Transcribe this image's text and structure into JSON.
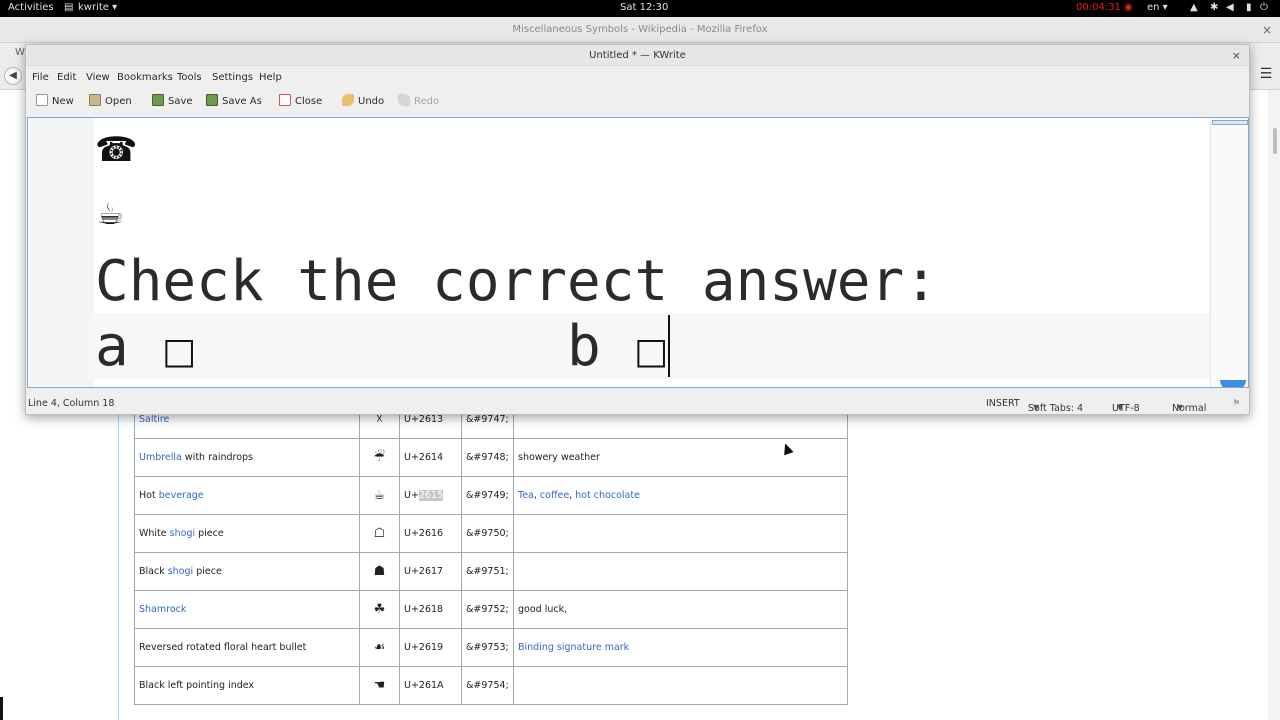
{
  "topbar": {
    "activities": "Activities",
    "app_menu": "kwrite ▾",
    "clock": "Sat 12:30",
    "recording_time": "00:04:31",
    "language": "en ▾",
    "status_icons": [
      "wifi-icon",
      "bluetooth-icon",
      "volume-icon",
      "battery-icon",
      "power-icon"
    ]
  },
  "firefox": {
    "window_title": "Miscellaneous Symbols - Wikipedia - Mozilla Firefox",
    "tab_initial": "W",
    "close_glyph": "×"
  },
  "wiki_table": {
    "rows": [
      {
        "name_parts": [
          {
            "text": "Saltire",
            "link": true
          }
        ],
        "glyph": "☓",
        "code": "U+2613",
        "entity": "&#9747;",
        "notes": []
      },
      {
        "name_parts": [
          {
            "text": "Umbrella",
            "link": true
          },
          {
            "text": " with raindrops",
            "link": false
          }
        ],
        "glyph": "☔",
        "code": "U+2614",
        "entity": "&#9748;",
        "notes": [
          {
            "text": "showery weather",
            "link": false
          }
        ]
      },
      {
        "name_parts": [
          {
            "text": "Hot ",
            "link": false
          },
          {
            "text": "beverage",
            "link": true
          }
        ],
        "glyph": "☕",
        "code": "U+2615",
        "entity": "&#9749;",
        "notes": [
          {
            "text": "Tea",
            "link": true
          },
          {
            "text": ", ",
            "link": false
          },
          {
            "text": "coffee",
            "link": true
          },
          {
            "text": ", ",
            "link": false
          },
          {
            "text": "hot chocolate",
            "link": true
          }
        ]
      },
      {
        "name_parts": [
          {
            "text": "White ",
            "link": false
          },
          {
            "text": "shogi",
            "link": true
          },
          {
            "text": " piece",
            "link": false
          }
        ],
        "glyph": "☖",
        "code": "U+2616",
        "entity": "&#9750;",
        "notes": []
      },
      {
        "name_parts": [
          {
            "text": "Black ",
            "link": false
          },
          {
            "text": "shogi",
            "link": true
          },
          {
            "text": " piece",
            "link": false
          }
        ],
        "glyph": "☗",
        "code": "U+2617",
        "entity": "&#9751;",
        "notes": []
      },
      {
        "name_parts": [
          {
            "text": "Shamrock",
            "link": true
          }
        ],
        "glyph": "☘",
        "code": "U+2618",
        "entity": "&#9752;",
        "notes": [
          {
            "text": "good luck,",
            "link": false
          }
        ]
      },
      {
        "name_parts": [
          {
            "text": "Reversed rotated floral heart bullet",
            "link": false
          }
        ],
        "glyph": "☙",
        "code": "U+2619",
        "entity": "&#9753;",
        "notes": [
          {
            "text": "Binding signature mark",
            "link": true
          }
        ]
      },
      {
        "name_parts": [
          {
            "text": "Black left pointing index",
            "link": false
          }
        ],
        "glyph": "☚",
        "code": "U+261A",
        "entity": "&#9754;",
        "notes": []
      }
    ]
  },
  "kwrite": {
    "window_title": "Untitled * — KWrite",
    "close_glyph": "×",
    "menu": [
      "File",
      "Edit",
      "View",
      "Bookmarks",
      "Tools",
      "Settings",
      "Help"
    ],
    "toolbar": {
      "new": "New",
      "open": "Open",
      "save": "Save",
      "save_as": "Save As",
      "close": "Close",
      "undo": "Undo",
      "redo": "Redo"
    },
    "editor": {
      "line1_glyph": "☎",
      "line2_glyph": "☕",
      "line3_text": "Check the correct answer:",
      "line4_a": "a",
      "line4_box_a": "□",
      "line4_b": "b",
      "line4_box_b": "□"
    },
    "status": {
      "position": "Line 4, Column 18",
      "mode": "INSERT",
      "tabs": "Soft Tabs: 4",
      "encoding": "UTF-8",
      "input_mode": "Normal"
    }
  }
}
